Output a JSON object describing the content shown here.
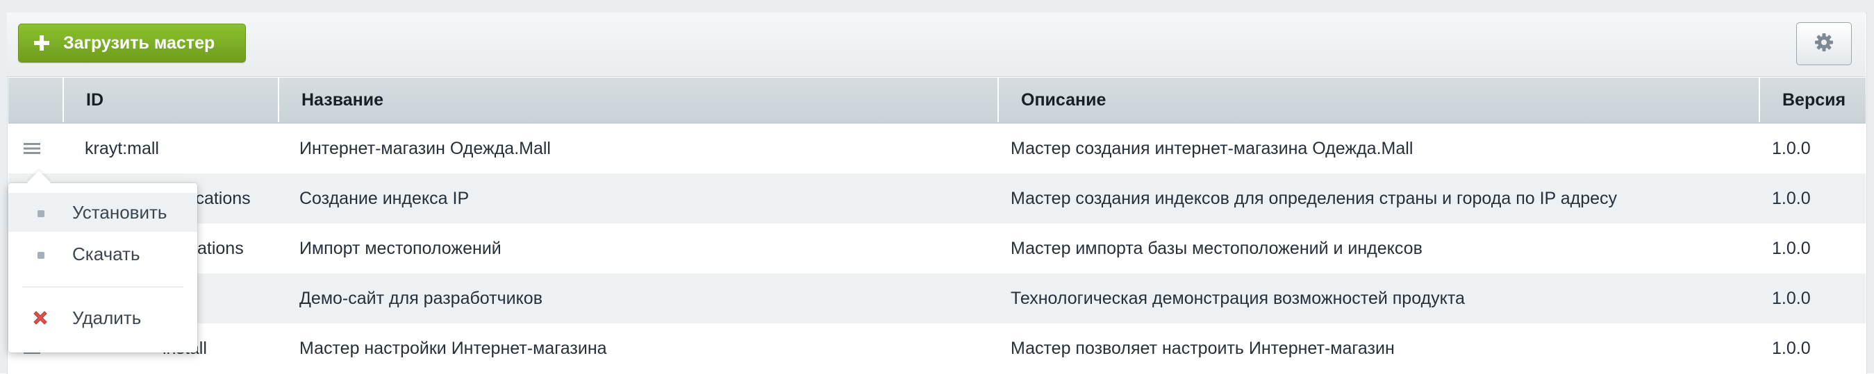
{
  "toolbar": {
    "add_label": "Загрузить мастер",
    "settings_icon": "gear-icon"
  },
  "columns": [
    "ID",
    "Название",
    "Описание",
    "Версия"
  ],
  "rows": [
    {
      "id": "krayt:mall",
      "name": "Интернет-магазин Одежда.Mall",
      "desc": "Мастер создания интернет-магазина Одежда.Mall",
      "version": "1.0.0"
    },
    {
      "id": "locations",
      "name": "Создание индекса IP",
      "desc": "Мастер создания индексов для определения страны и города по IP адресу",
      "version": "1.0.0"
    },
    {
      "id": "ations",
      "name": "Импорт местоположений",
      "desc": "Мастер импорта базы местоположений и индексов",
      "version": "1.0.0"
    },
    {
      "id": "",
      "name": "Демо-сайт для разработчиков",
      "desc": "Технологическая демонстрация возможностей продукта",
      "version": "1.0.0"
    },
    {
      "id": "install",
      "name": "Мастер настройки Интернет-магазина",
      "desc": "Мастер позволяет настроить Интернет-магазин",
      "version": "1.0.0"
    }
  ],
  "context_menu": {
    "install": "Установить",
    "download": "Скачать",
    "delete": "Удалить"
  },
  "colors": {
    "accent_green": "#7aab22",
    "delete_red": "#d9534f",
    "header_bg": "#cfd7dc",
    "row_alt_bg": "#eef1f3"
  }
}
